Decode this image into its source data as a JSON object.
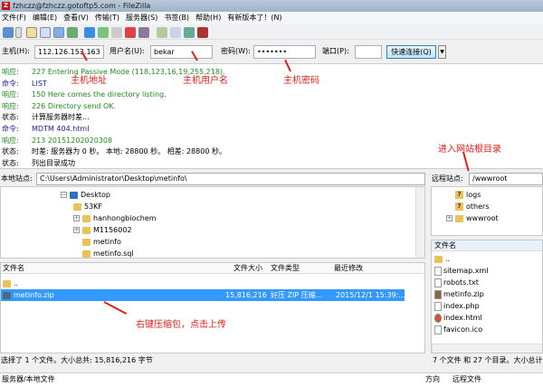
{
  "window": {
    "title": "fzhczz@fzhczz.gotoftp5.com - FileZilla"
  },
  "menu": [
    "文件(F)",
    "编辑(E)",
    "查看(V)",
    "传输(T)",
    "服务器(S)",
    "书签(B)",
    "帮助(H)",
    "有新版本了！(N)"
  ],
  "quickconnect": {
    "host_label": "主机(H):",
    "host": "112.126.153.163",
    "user_label": "用户名(U):",
    "user": "bekar",
    "pass_label": "密码(W):",
    "pass": "•••••••",
    "port_label": "端口(P):",
    "port": "",
    "button": "快速连接(Q)"
  },
  "log": [
    {
      "k": "响应:",
      "v": "227 Entering Passive Mode (118,123,16,19,255,218).",
      "t": "resp"
    },
    {
      "k": "命令:",
      "v": "LIST",
      "t": "cmd"
    },
    {
      "k": "响应:",
      "v": "150 Here comes the directory listing.",
      "t": "resp"
    },
    {
      "k": "响应:",
      "v": "226 Directory send OK.",
      "t": "resp"
    },
    {
      "k": "状态:",
      "v": "计算服务器时差...",
      "t": "stat"
    },
    {
      "k": "命令:",
      "v": "MDTM 404.html",
      "t": "cmd"
    },
    {
      "k": "响应:",
      "v": "213 20151202020308",
      "t": "resp"
    },
    {
      "k": "状态:",
      "v": "时差: 服务器为 0 秒。 本地: 28800 秒。 相差: 28800 秒。",
      "t": "stat"
    },
    {
      "k": "状态:",
      "v": "列出目录成功",
      "t": "stat"
    }
  ],
  "annotations": {
    "host": "主机地址",
    "user": "主机用户名",
    "pass": "主机密码",
    "root": "进入网站根目录",
    "upload": "右键压缩包，点击上传"
  },
  "local": {
    "label": "本地站点:",
    "path": "C:\\Users\\Administrator\\Desktop\\metinfo\\",
    "tree": [
      "Desktop",
      "53KF",
      "hanhongbiochem",
      "M1156002",
      "metinfo",
      "metinfo.sql"
    ],
    "headers": [
      "文件名",
      "文件大小",
      "文件类型",
      "最近修改"
    ],
    "files": [
      {
        "name": "..",
        "size": "",
        "type": "",
        "date": ""
      },
      {
        "name": "metinfo.zip",
        "size": "15,816,216",
        "type": "好压 ZIP 压缩...",
        "date": "2015/12/1 15:39:..."
      }
    ],
    "status": "选择了 1 个文件。大小总共: 15,816,216 字节"
  },
  "remote": {
    "label": "远程站点:",
    "path": "/wwwroot",
    "tree": [
      "logs",
      "others",
      "wwwroot"
    ],
    "header": "文件名",
    "files": [
      "..",
      "sitemap.xml",
      "robots.txt",
      "metinfo.zip",
      "index.php",
      "index.html",
      "favicon.ico"
    ],
    "status": "7 个文件 和 27 个目录。大小总计"
  },
  "queue": {
    "headers": [
      "服务器/本地文件",
      "方向",
      "远程文件"
    ]
  }
}
